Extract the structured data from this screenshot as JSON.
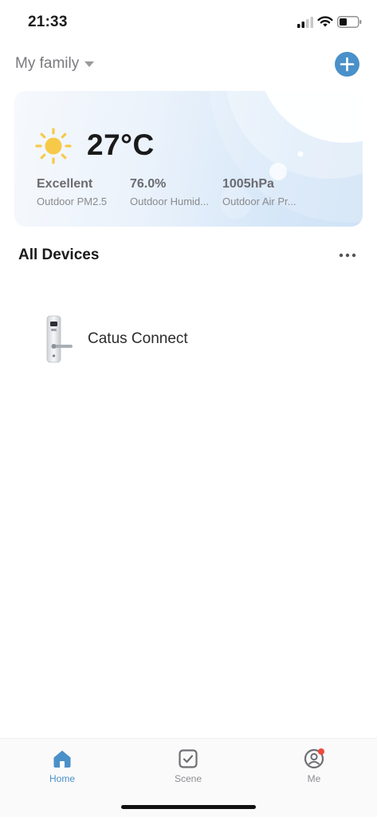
{
  "status_bar": {
    "time": "21:33",
    "icons": [
      "cellular-signal-icon",
      "wifi-icon",
      "battery-icon"
    ],
    "battery_level": 0.35
  },
  "header": {
    "family_name": "My family",
    "add_icon": "plus-icon",
    "accent_color": "#4a90c9"
  },
  "weather": {
    "icon": "sun-icon",
    "temperature": "27°C",
    "metrics": [
      {
        "value": "Excellent",
        "label": "Outdoor PM2.5"
      },
      {
        "value": "76.0%",
        "label": "Outdoor Humid..."
      },
      {
        "value": "1005hPa",
        "label": "Outdoor Air Pr..."
      }
    ]
  },
  "devices": {
    "title": "All Devices",
    "more_icon": "more-dots-icon",
    "items": [
      {
        "name": "Catus Connect",
        "icon": "smart-lock-icon"
      }
    ]
  },
  "tab_bar": {
    "tabs": [
      {
        "label": "Home",
        "icon": "home-icon",
        "active": true
      },
      {
        "label": "Scene",
        "icon": "scene-checkbox-icon",
        "active": false
      },
      {
        "label": "Me",
        "icon": "profile-icon",
        "active": false,
        "badge": true
      }
    ],
    "active_color": "#4a90c9",
    "inactive_color": "#8e8e93"
  }
}
